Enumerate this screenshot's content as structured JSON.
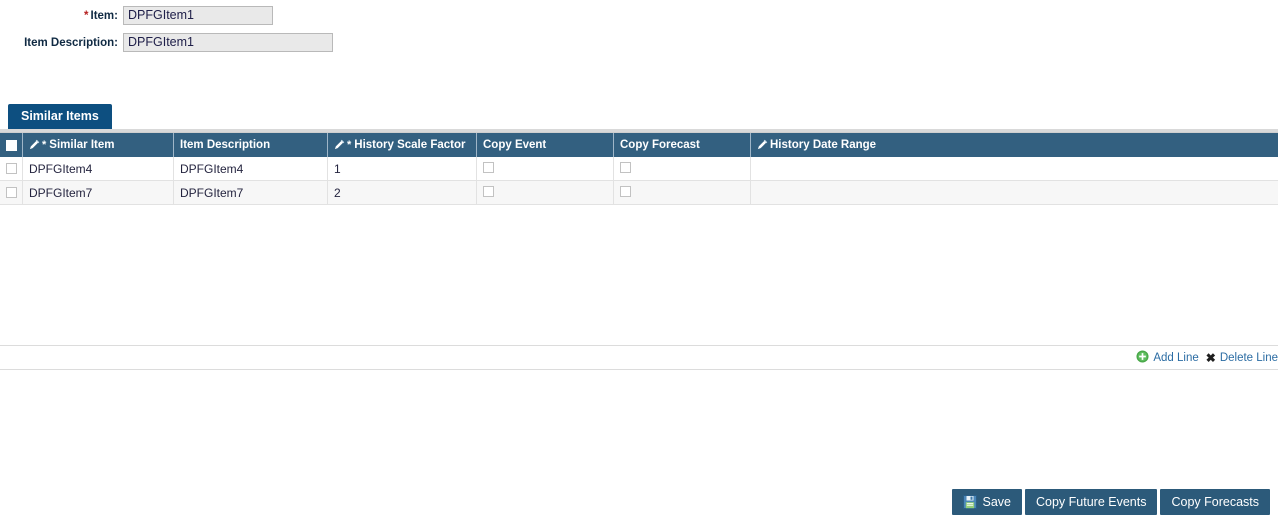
{
  "form": {
    "item": {
      "label": "Item:",
      "required_marker": "*",
      "value": "DPFGItem1"
    },
    "item_description": {
      "label": "Item Description:",
      "value": "DPFGItem1"
    }
  },
  "panel": {
    "tab_label": "Similar Items"
  },
  "grid": {
    "columns": [
      {
        "key": "select",
        "label": "",
        "icon": "",
        "required": false
      },
      {
        "key": "similar_item",
        "label": "Similar Item",
        "icon": "pencil-icon",
        "required": true
      },
      {
        "key": "description",
        "label": "Item Description",
        "icon": "",
        "required": false
      },
      {
        "key": "scale_factor",
        "label": "History Scale Factor",
        "icon": "pencil-icon",
        "required": true
      },
      {
        "key": "copy_event",
        "label": "Copy Event",
        "icon": "",
        "required": false
      },
      {
        "key": "copy_forecast",
        "label": "Copy Forecast",
        "icon": "",
        "required": false
      },
      {
        "key": "date_range",
        "label": "History Date Range",
        "icon": "pencil-icon",
        "required": false
      }
    ],
    "rows": [
      {
        "selected": false,
        "similar_item": "DPFGItem4",
        "description": "DPFGItem4",
        "scale_factor": "1",
        "copy_event": false,
        "copy_forecast": false,
        "date_range": ""
      },
      {
        "selected": false,
        "similar_item": "DPFGItem7",
        "description": "DPFGItem7",
        "scale_factor": "2",
        "copy_event": false,
        "copy_forecast": false,
        "date_range": ""
      }
    ],
    "header_select_all": false,
    "toolbar": {
      "add_line_label": "Add Line",
      "add_line_icon": "plus-circle-icon",
      "delete_line_label": "Delete Line",
      "delete_line_icon": "x-icon"
    }
  },
  "footer": {
    "buttons": [
      {
        "key": "save",
        "label": "Save",
        "icon": "floppy-disk-icon"
      },
      {
        "key": "copy_future_events",
        "label": "Copy Future Events",
        "icon": ""
      },
      {
        "key": "copy_forecasts",
        "label": "Copy Forecasts",
        "icon": ""
      }
    ]
  },
  "colors": {
    "tab_blue": "#0d4f80",
    "header_blue": "#336080",
    "button_blue": "#2c5a7a",
    "link_blue": "#2b6ca3",
    "required_red": "#b51f1f",
    "add_green": "#3f9a3f",
    "row_alt": "#f7f7f7"
  }
}
